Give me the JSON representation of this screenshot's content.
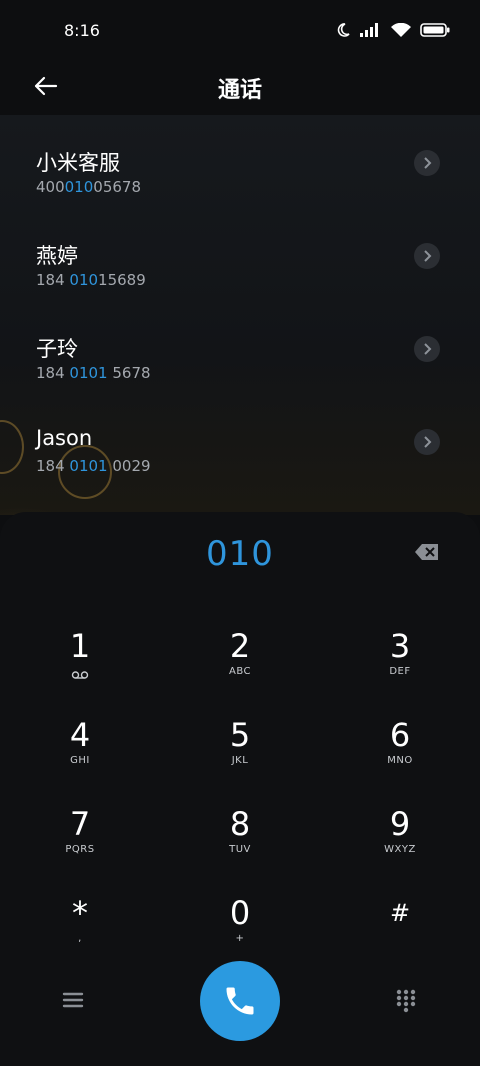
{
  "status_bar": {
    "time": "8:16"
  },
  "header": {
    "title": "通话"
  },
  "contacts": [
    {
      "name": "小米客服",
      "num_pre": "400",
      "num_hl": "010",
      "num_post": "05678"
    },
    {
      "name": "燕婷",
      "num_pre": "184 ",
      "num_hl": "010",
      "num_post": "15689"
    },
    {
      "name": "子玲",
      "num_pre": "184 ",
      "num_hl": "0101",
      "num_post": " 5678"
    },
    {
      "name": "Jason",
      "num_pre": "184 ",
      "num_hl": "0101",
      "num_post": " 0029"
    }
  ],
  "dialer": {
    "digits": "010",
    "keys": [
      {
        "digit": "1",
        "sub": ""
      },
      {
        "digit": "2",
        "sub": "ABC"
      },
      {
        "digit": "3",
        "sub": "DEF"
      },
      {
        "digit": "4",
        "sub": "GHI"
      },
      {
        "digit": "5",
        "sub": "JKL"
      },
      {
        "digit": "6",
        "sub": "MNO"
      },
      {
        "digit": "7",
        "sub": "PQRS"
      },
      {
        "digit": "8",
        "sub": "TUV"
      },
      {
        "digit": "9",
        "sub": "WXYZ"
      },
      {
        "digit": "*",
        "sub": ","
      },
      {
        "digit": "0",
        "sub": "+"
      },
      {
        "digit": "#",
        "sub": ""
      }
    ]
  },
  "icons": {
    "status": [
      "moon-icon",
      "signal-icon",
      "wifi-icon",
      "battery-icon"
    ],
    "header": "back-arrow-icon",
    "bottom": [
      "menu-icon",
      "phone-icon",
      "keypad-icon"
    ]
  },
  "colors": {
    "accent": "#2f95dc",
    "call_button": "#2b9ae0",
    "background": "#0d0e10"
  }
}
